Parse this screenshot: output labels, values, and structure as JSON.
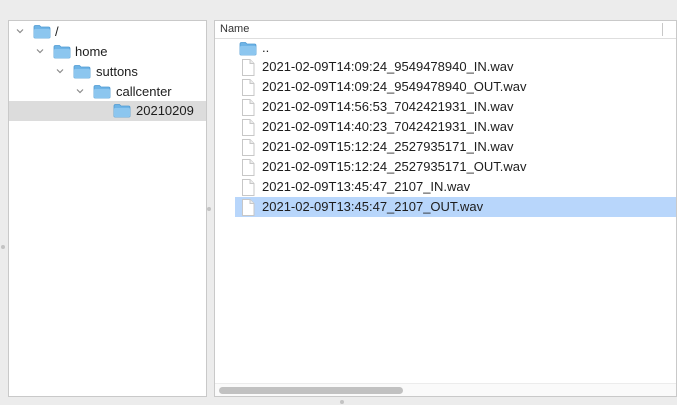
{
  "tree": {
    "items": [
      {
        "label": "/",
        "level": 0
      },
      {
        "label": "home",
        "level": 1
      },
      {
        "label": "suttons",
        "level": 2
      },
      {
        "label": "callcenter",
        "level": 3
      },
      {
        "label": "20210209",
        "level": 4,
        "selected": true
      }
    ]
  },
  "files": {
    "column_name": "Name",
    "parent_entry": "..",
    "items": [
      "2021-02-09T14:09:24_9549478940_IN.wav",
      "2021-02-09T14:09:24_9549478940_OUT.wav",
      "2021-02-09T14:56:53_7042421931_IN.wav",
      "2021-02-09T14:40:23_7042421931_IN.wav",
      "2021-02-09T15:12:24_2527935171_IN.wav",
      "2021-02-09T15:12:24_2527935171_OUT.wav",
      "2021-02-09T13:45:47_2107_IN.wav",
      "2021-02-09T13:45:47_2107_OUT.wav"
    ],
    "selected_index": 7
  },
  "colors": {
    "folder": "#6fb4e6",
    "selection": "#b8d6fb",
    "tree_selection": "#dcdcdc"
  },
  "icons": {
    "folder": "folder-icon",
    "file": "document-icon",
    "expand": "chevron-down-icon"
  }
}
